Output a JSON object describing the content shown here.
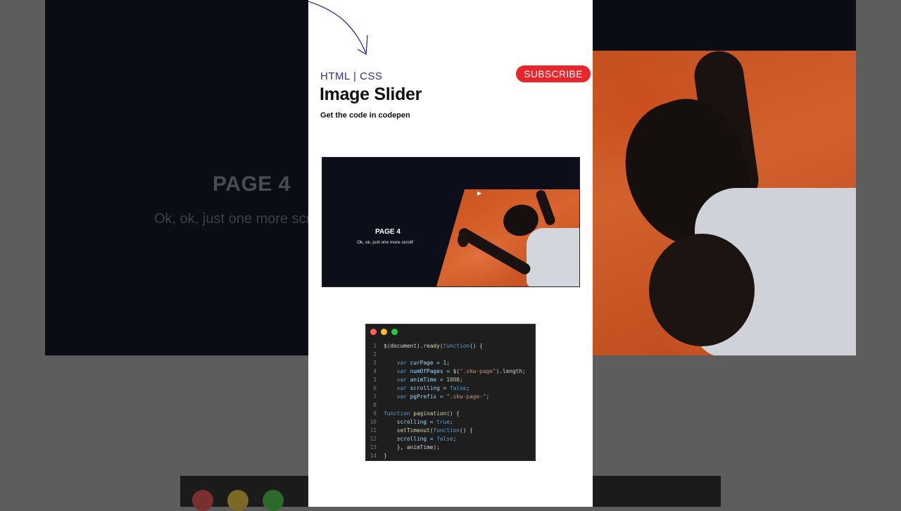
{
  "background": {
    "page_title": "PAGE 4",
    "page_subtitle": "Ok, ok, just one more scroll!"
  },
  "card": {
    "tech_label": "HTML |  CSS",
    "title": "Image Slider",
    "subtitle": "Get the code in codepen",
    "subscribe_label": "SUBSCRIBE"
  },
  "preview": {
    "page_title": "PAGE 4",
    "page_subtitle": "Ok, ok, just one more scroll!"
  },
  "code": {
    "window_dots": [
      "#ff5f56",
      "#ffbd2e",
      "#27c93f"
    ],
    "lines": [
      {
        "n": "1",
        "tokens": [
          [
            "$(document).",
            "pl"
          ],
          [
            "ready",
            "fn"
          ],
          [
            "(",
            "pl"
          ],
          [
            "function",
            "kw"
          ],
          [
            "() {",
            "pl"
          ]
        ]
      },
      {
        "n": "2",
        "tokens": []
      },
      {
        "n": "3",
        "tokens": [
          [
            "    ",
            "pl"
          ],
          [
            "var",
            "kw"
          ],
          [
            " curPage = ",
            "var"
          ],
          [
            "1",
            "num"
          ],
          [
            ";",
            "pl"
          ]
        ]
      },
      {
        "n": "4",
        "tokens": [
          [
            "    ",
            "pl"
          ],
          [
            "var",
            "kw"
          ],
          [
            " numOfPages = ",
            "var"
          ],
          [
            "$(",
            "pl"
          ],
          [
            "\".skw-page\"",
            "str"
          ],
          [
            ").length;",
            "pl"
          ]
        ]
      },
      {
        "n": "5",
        "tokens": [
          [
            "    ",
            "pl"
          ],
          [
            "var",
            "kw"
          ],
          [
            " animTime = ",
            "var"
          ],
          [
            "1000",
            "num"
          ],
          [
            ";",
            "pl"
          ]
        ]
      },
      {
        "n": "6",
        "tokens": [
          [
            "    ",
            "pl"
          ],
          [
            "var",
            "kw"
          ],
          [
            " scrolling = ",
            "var"
          ],
          [
            "false",
            "kw"
          ],
          [
            ";",
            "pl"
          ]
        ]
      },
      {
        "n": "7",
        "tokens": [
          [
            "    ",
            "pl"
          ],
          [
            "var",
            "kw"
          ],
          [
            " pgPrefix = ",
            "var"
          ],
          [
            "\".skw-page-\"",
            "str"
          ],
          [
            ";",
            "pl"
          ]
        ]
      },
      {
        "n": "8",
        "tokens": []
      },
      {
        "n": "9",
        "tokens": [
          [
            "function",
            "kw"
          ],
          [
            " ",
            "pl"
          ],
          [
            "pagination",
            "fn"
          ],
          [
            "() {",
            "pl"
          ]
        ]
      },
      {
        "n": "10",
        "tokens": [
          [
            "    scrolling = ",
            "var"
          ],
          [
            "true",
            "kw"
          ],
          [
            ";",
            "pl"
          ]
        ]
      },
      {
        "n": "11",
        "tokens": [
          [
            "    ",
            "pl"
          ],
          [
            "setTimeout",
            "fn"
          ],
          [
            "(",
            "pl"
          ],
          [
            "function",
            "kw"
          ],
          [
            "() {",
            "pl"
          ]
        ]
      },
      {
        "n": "12",
        "tokens": [
          [
            "    scrolling = ",
            "var"
          ],
          [
            "false",
            "kw"
          ],
          [
            ";",
            "pl"
          ]
        ]
      },
      {
        "n": "13",
        "tokens": [
          [
            "    }, animTime);",
            "pl"
          ]
        ]
      },
      {
        "n": "14",
        "tokens": [
          [
            "}",
            "pl"
          ]
        ]
      }
    ]
  }
}
